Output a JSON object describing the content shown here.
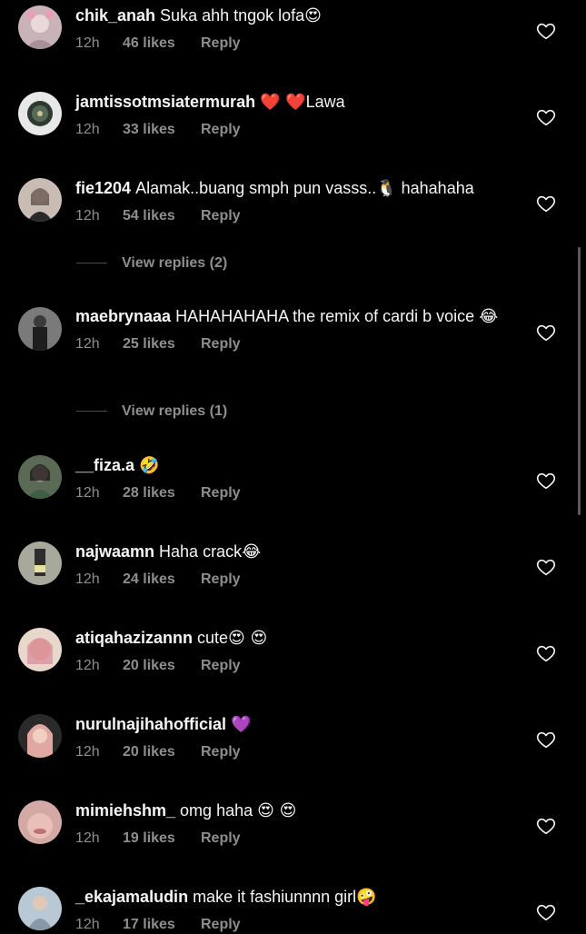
{
  "comments": [
    {
      "username": "chik_anah",
      "text": "Suka ahh tngok lofa",
      "emoji": "😍",
      "time": "12h",
      "likes": "46 likes",
      "reply": "Reply",
      "avatar_color": "#c9b3b8"
    },
    {
      "username": "jamtissotmsiatermurah",
      "text": "",
      "emoji": "❤️ ❤️",
      "text_after": "Lawa",
      "time": "12h",
      "likes": "33 likes",
      "reply": "Reply",
      "avatar_color": "#3b4a3e"
    },
    {
      "username": "fie1204",
      "text": "Alamak..buang smph pun vasss..",
      "emoji": "🐧",
      "text_after": "hahahaha",
      "time": "12h",
      "likes": "54 likes",
      "reply": "Reply",
      "avatar_color": "#b8a9a0"
    },
    {
      "username": "maebrynaaa",
      "text": "HAHAHAHAHA the remix of cardi b voice",
      "emoji": "😂",
      "time": "12h",
      "likes": "25 likes",
      "reply": "Reply",
      "avatar_color": "#6b6b6b"
    },
    {
      "username": "__fiza.a",
      "text": "",
      "emoji": "🤣",
      "time": "12h",
      "likes": "28 likes",
      "reply": "Reply",
      "avatar_color": "#4a5a44"
    },
    {
      "username": "najwaamn",
      "text": "Haha crack",
      "emoji": "😂",
      "time": "12h",
      "likes": "24 likes",
      "reply": "Reply",
      "avatar_color": "#9a9a8e"
    },
    {
      "username": "atiqahazizannn",
      "text": "cute",
      "emoji": "😍 😍",
      "time": "12h",
      "likes": "20 likes",
      "reply": "Reply",
      "avatar_color": "#d9b8a8"
    },
    {
      "username": "nurulnajihahofficial",
      "text": "",
      "emoji": "💜",
      "time": "12h",
      "likes": "20 likes",
      "reply": "Reply",
      "avatar_color": "#c49a8e"
    },
    {
      "username": "mimiehshm_",
      "text": "omg haha",
      "emoji": "😍 😍",
      "time": "12h",
      "likes": "19 likes",
      "reply": "Reply",
      "avatar_color": "#d4a8a4"
    },
    {
      "username": "_ekajamaludin",
      "text": "make it fashiunnnn girl",
      "emoji": "🤪",
      "time": "12h",
      "likes": "17 likes",
      "reply": "Reply",
      "avatar_color": "#a8b8c4"
    }
  ],
  "view_replies": [
    {
      "label": "View replies (2)"
    },
    {
      "label": "View replies (1)"
    }
  ],
  "icons": {
    "heart": "heart-outline-icon"
  },
  "colors": {
    "background": "#000000",
    "text": "#f5f5f5",
    "meta": "#8e8e8e"
  }
}
